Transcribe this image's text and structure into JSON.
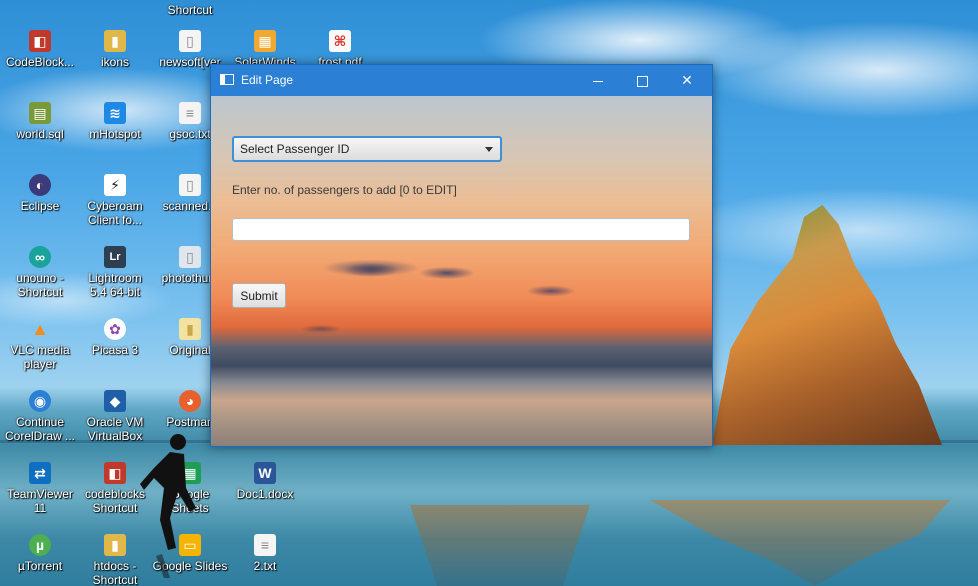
{
  "desktop": {
    "icons": [
      {
        "label": "Shortcut",
        "glyph": "",
        "color": "#2b6cb0"
      },
      {
        "label": "CodeBlock...",
        "glyph": "◧",
        "color": "#c0392b"
      },
      {
        "label": "ikons",
        "glyph": "▮",
        "color": "#e0b84a"
      },
      {
        "label": "newsoft[ver",
        "glyph": "▯",
        "color": "#ffffff"
      },
      {
        "label": "SolarWinds",
        "glyph": "▦",
        "color": "#f0a830"
      },
      {
        "label": "frost.pdf",
        "glyph": "⌘",
        "color": "#d9342b"
      },
      {
        "label": "world.sql",
        "glyph": "▤",
        "color": "#7a9a3a"
      },
      {
        "label": "mHotspot",
        "glyph": "≋",
        "color": "#1e88e5"
      },
      {
        "label": "gsoc.txt",
        "glyph": "≡",
        "color": "#ffffff"
      },
      {
        "label": "Eclipse",
        "glyph": "◐",
        "color": "#3b3a7a"
      },
      {
        "label": "Cyberoam\nClient fo...",
        "glyph": "⚡",
        "color": "#222222"
      },
      {
        "label": "scanned.J",
        "glyph": "▯",
        "color": "#ffffff"
      },
      {
        "label": "unouno -\nShortcut",
        "glyph": "∞",
        "color": "#1aa39a"
      },
      {
        "label": "Lightroom\n5.4 64-bit",
        "glyph": "Lr",
        "color": "#2c3e50"
      },
      {
        "label": "photothum",
        "glyph": "▯",
        "color": "#dfe6ee"
      },
      {
        "label": "VLC media\nplayer",
        "glyph": "▲",
        "color": "#f28c1c"
      },
      {
        "label": "Picasa 3",
        "glyph": "✿",
        "color": "#8e44ad"
      },
      {
        "label": "Original",
        "glyph": "▮",
        "color": "#f3e2a0"
      },
      {
        "label": "Continue\nCorelDraw ...",
        "glyph": "◉",
        "color": "#2d7fd3"
      },
      {
        "label": "Oracle VM\nVirtualBox",
        "glyph": "◆",
        "color": "#1f5fa8"
      },
      {
        "label": "Postman",
        "glyph": "◕",
        "color": "#e8602c"
      },
      {
        "label": "TeamViewer\n11",
        "glyph": "⇄",
        "color": "#0e6fc2"
      },
      {
        "label": "codeblocks\nShortcut",
        "glyph": "◧",
        "color": "#c0392b"
      },
      {
        "label": "Google\nSheets",
        "glyph": "▦",
        "color": "#1e9e55"
      },
      {
        "label": "Doc1.docx",
        "glyph": "W",
        "color": "#2a5699"
      },
      {
        "label": "µTorrent",
        "glyph": "µ",
        "color": "#4caf50"
      },
      {
        "label": "htdocs -\nShortcut",
        "glyph": "▮",
        "color": "#e0b84a"
      },
      {
        "label": "Google Slides",
        "glyph": "▭",
        "color": "#f4b400"
      },
      {
        "label": "2.txt",
        "glyph": "≡",
        "color": "#ffffff"
      }
    ]
  },
  "window": {
    "title": "Edit Page",
    "minimize_label": "",
    "maximize_label": "",
    "close_label": "✕",
    "accent": "#2b7fd4"
  },
  "form": {
    "select_label": "Select Passenger ID",
    "prompt": "Enter no. of passengers to add [0 to EDIT]",
    "input_value": "",
    "input_placeholder": "",
    "submit_label": "Submit"
  }
}
